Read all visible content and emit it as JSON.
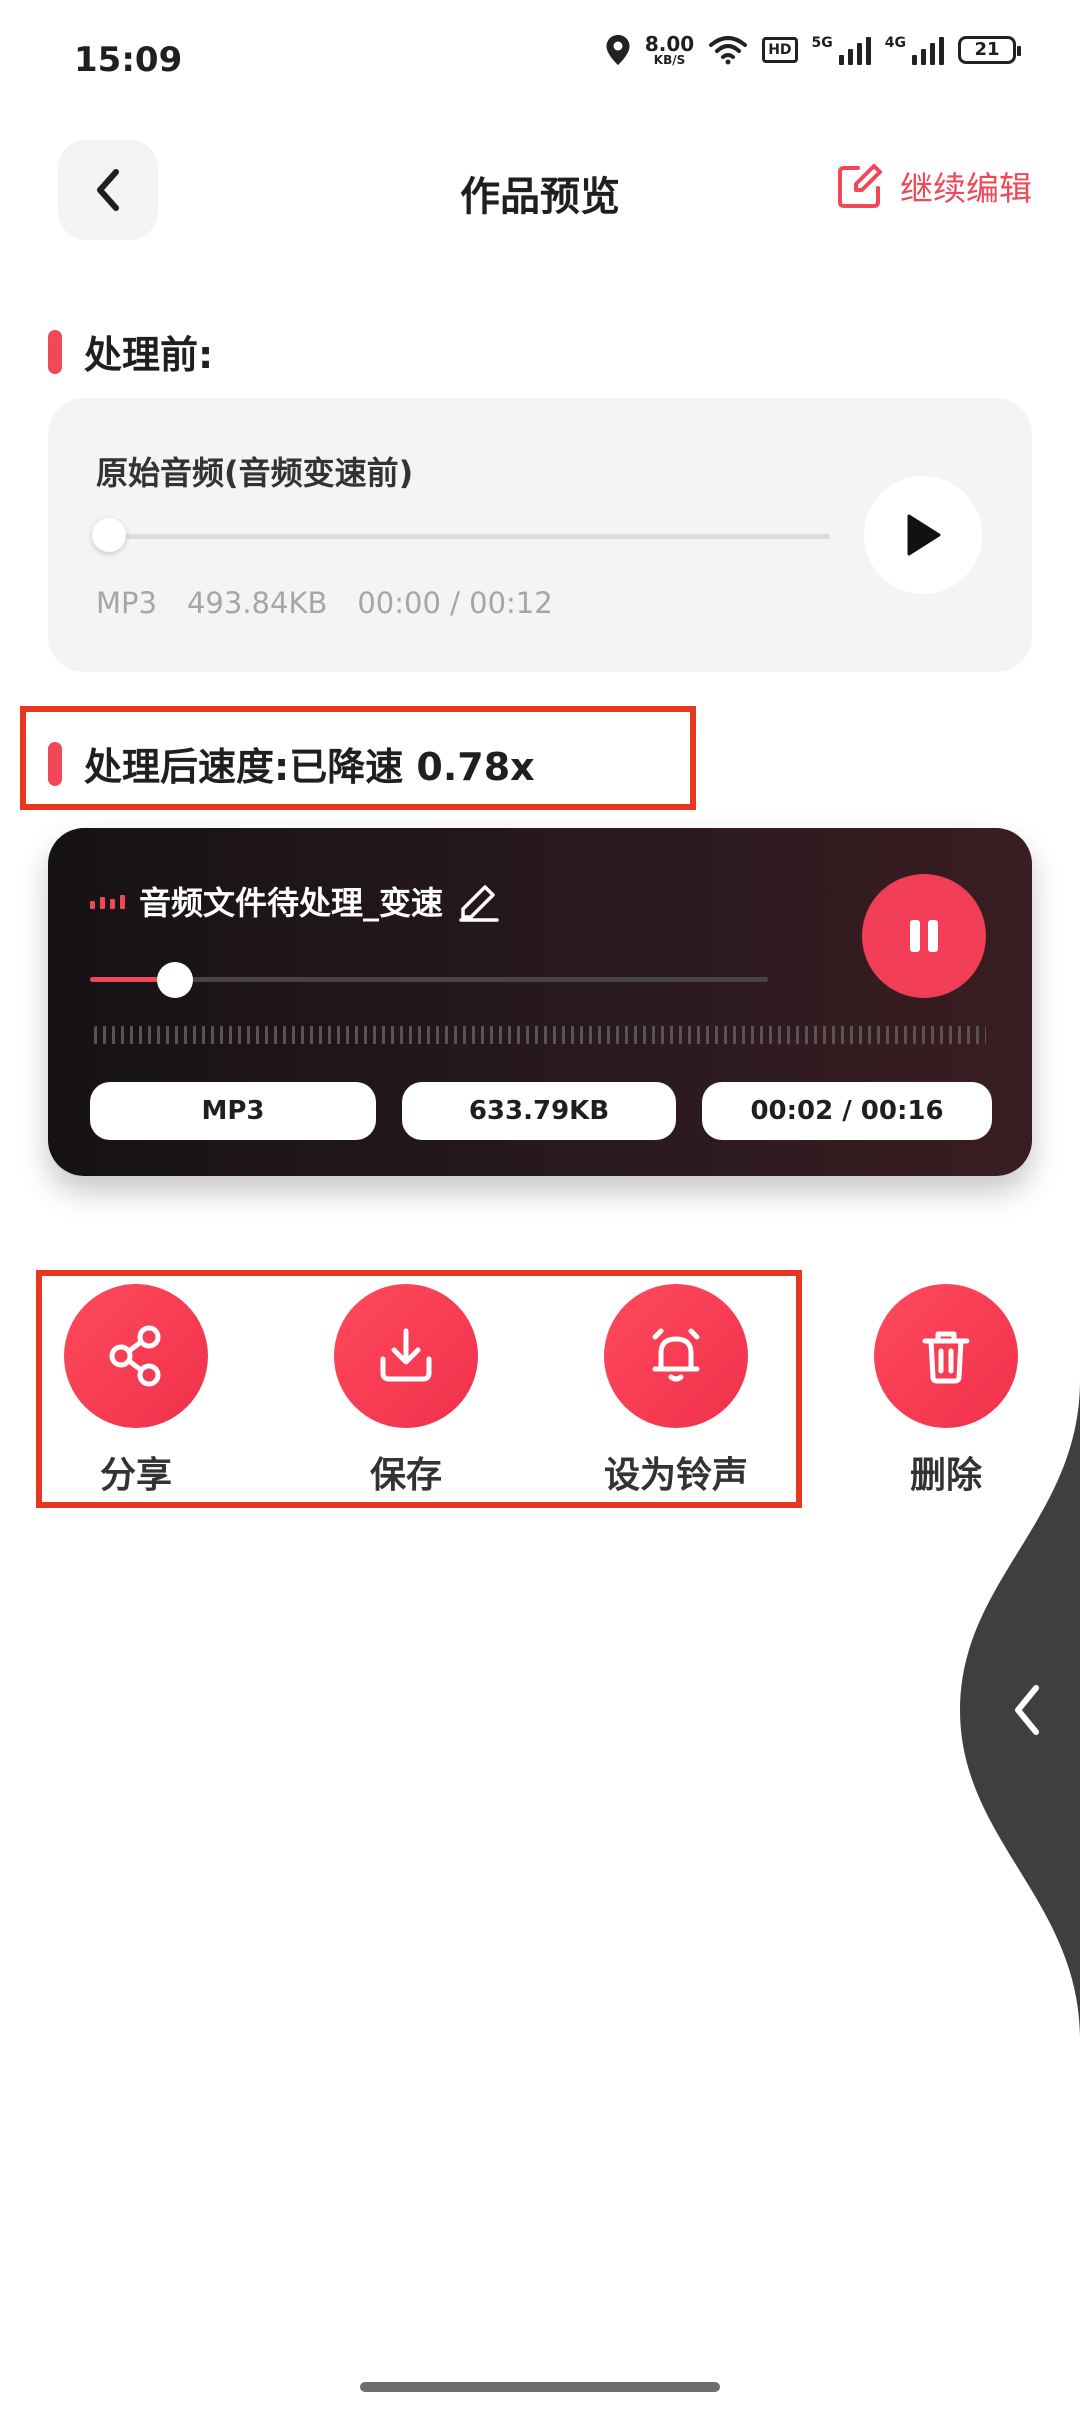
{
  "status_bar": {
    "time": "15:09",
    "net_speed_value": "8.00",
    "net_speed_unit": "KB/S",
    "hd_label": "HD",
    "sim1_label": "5G",
    "sim2_label": "4G",
    "battery": "21"
  },
  "header": {
    "title": "作品预览",
    "continue_edit_label": "继续编辑"
  },
  "before": {
    "section_label": "处理前:",
    "card_title": "原始音频(音频变速前)",
    "format": "MP3",
    "size": "493.84KB",
    "time": "00:00 / 00:12"
  },
  "after": {
    "section_label": "处理后速度:已降速 0.78x",
    "file_name": "音频文件待处理_变速",
    "format": "MP3",
    "size": "633.79KB",
    "time": "00:02 / 00:16",
    "progress": 0.125
  },
  "actions": [
    {
      "label": "分享",
      "icon": "share-icon"
    },
    {
      "label": "保存",
      "icon": "download-icon"
    },
    {
      "label": "设为铃声",
      "icon": "bell-icon"
    },
    {
      "label": "删除",
      "icon": "trash-icon"
    }
  ],
  "colors": {
    "accent": "#f04856",
    "highlight_frame": "#e8371f"
  }
}
